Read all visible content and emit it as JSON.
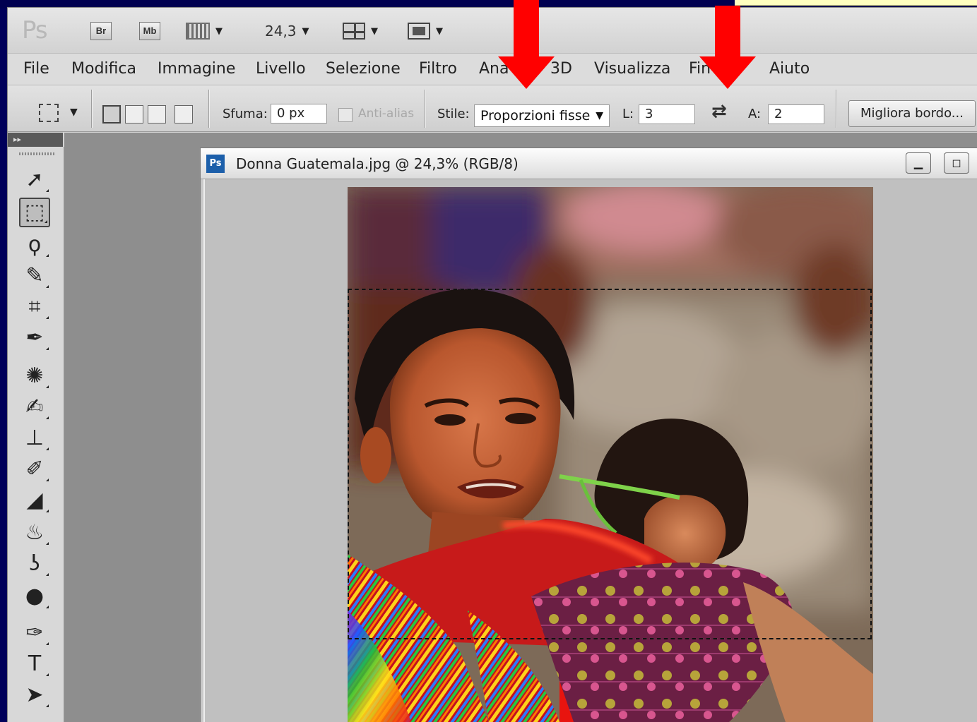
{
  "app": {
    "logo": "Ps",
    "bridge_label": "Br",
    "minibridge_label": "Mb",
    "zoom_value": "24,3"
  },
  "menu": {
    "items": [
      "File",
      "Modifica",
      "Immagine",
      "Livello",
      "Selezione",
      "Filtro",
      "Ana",
      "3D",
      "Visualizza",
      "Fin",
      "Aiuto"
    ]
  },
  "options": {
    "feather_label": "Sfuma:",
    "feather_value": "0 px",
    "antialias_label": "Anti-alias",
    "style_label": "Stile:",
    "style_value": "Proporzioni fisse",
    "width_label": "L:",
    "width_value": "3",
    "height_label": "A:",
    "height_value": "2",
    "refine_edge_label": "Migliora bordo..."
  },
  "document": {
    "title": "Donna Guatemala.jpg @ 24,3% (RGB/8)",
    "icon_label": "Ps"
  },
  "colors": {
    "slide_background": "#00005a",
    "arrow": "#ff0000",
    "doc_icon": "#1c5faa"
  },
  "toolbox": {
    "tools": [
      "move-tool",
      "rect-marquee-tool",
      "lasso-tool",
      "quick-selection-tool",
      "crop-tool",
      "eyedropper-tool",
      "spot-healing-tool",
      "brush-tool",
      "clone-stamp-tool",
      "history-brush-tool",
      "eraser-tool",
      "paint-bucket-tool",
      "smudge-tool",
      "dodge-tool",
      "pen-tool",
      "type-tool",
      "path-selection-tool",
      "shape-tool"
    ]
  }
}
